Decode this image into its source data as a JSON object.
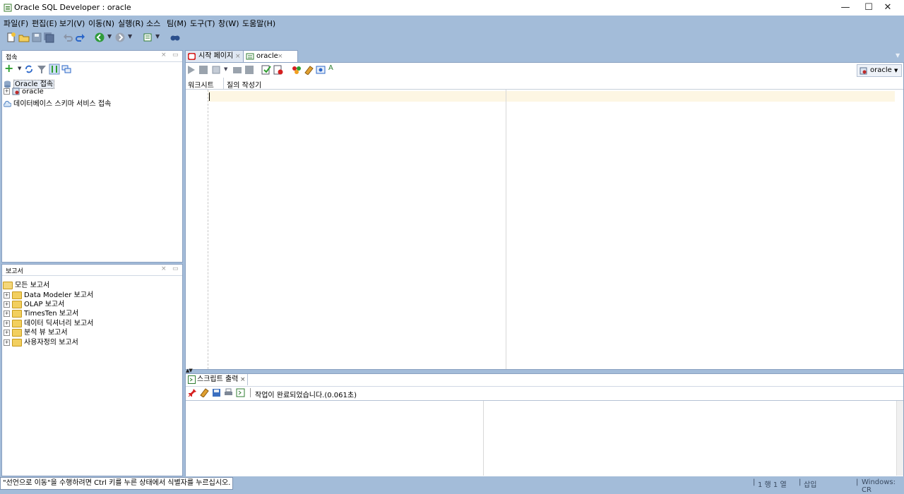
{
  "window": {
    "title": "Oracle SQL Developer : oracle",
    "min_glyph": "—",
    "max_glyph": "☐",
    "close_glyph": "✕"
  },
  "menu": [
    "파일(F)",
    "편집(E)",
    "보기(V)",
    "이동(N)",
    "실행(R)",
    "소스",
    "팀(M)",
    "도구(T)",
    "창(W)",
    "도움말(H)"
  ],
  "toolbar": {
    "icons": [
      "new-icon",
      "open-icon",
      "save-icon",
      "save-all-icon",
      "undo-icon",
      "redo-icon",
      "back-icon",
      "forward-icon",
      "sql-icon",
      "monitor-icon"
    ]
  },
  "connections": {
    "title": "접속",
    "close": "×",
    "minimize": "▭",
    "add": "+",
    "items": [
      {
        "label": "Oracle 접속",
        "level": 0
      },
      {
        "label": "oracle",
        "level": 1,
        "expander": "+"
      },
      {
        "label": "데이터베이스 스키마 서비스 접속",
        "level": 0
      }
    ]
  },
  "reports": {
    "title": "보고서",
    "close": "×",
    "minimize": "▭",
    "root": "모든 보고서",
    "items": [
      "Data Modeler 보고서",
      "OLAP 보고서",
      "TimesTen 보고서",
      "데이터 딕셔너리 보고서",
      "분석 뷰 보고서",
      "사용자정의 보고서"
    ],
    "expander": "+"
  },
  "editor": {
    "tabs": [
      {
        "label": "시작 페이지",
        "close": "×"
      },
      {
        "label": "oracle",
        "close": "×"
      }
    ],
    "subtabs": [
      "워크시트",
      "질의 작성기"
    ],
    "connection_selector": "oracle"
  },
  "output": {
    "tab_label": "스크립트 출력",
    "tab_close": "×",
    "message": "작업이 완료되었습니다.(0.061초)"
  },
  "status": {
    "message": "\"선언으로 이동\"을 수행하려면 Ctrl 키를 누른 상태에서 식별자를 누르십시오.",
    "position": "1 행 1 열",
    "mode": "삽입",
    "line_ending": "Windows: CR"
  },
  "colors": {
    "frame": "#a3bcd9",
    "current_line": "#fdf6e3",
    "pin": "#d62020"
  }
}
